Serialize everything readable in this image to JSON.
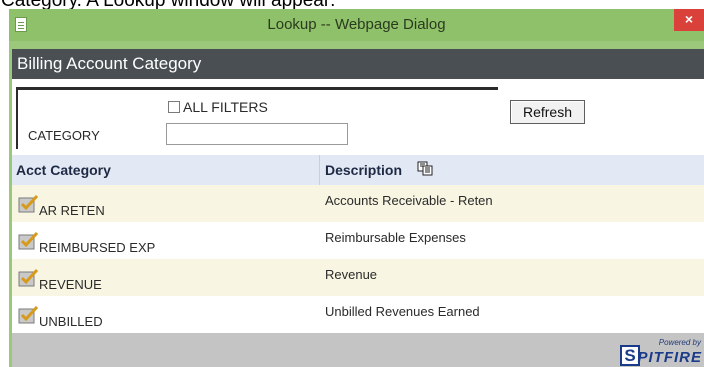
{
  "caption": "Category.  A Lookup window will appear:",
  "window": {
    "title": "Lookup -- Webpage Dialog",
    "close": "×"
  },
  "header": {
    "title": "Billing Account Category"
  },
  "filters": {
    "all_filters_label": "ALL FILTERS",
    "all_filters_checked": false,
    "category_label": "CATEGORY",
    "category_value": "",
    "refresh_label": "Refresh"
  },
  "grid": {
    "columns": [
      "Acct Category",
      "Description"
    ],
    "rows": [
      {
        "category": "AR RETEN",
        "description": "Accounts Receivable - Reten"
      },
      {
        "category": "REIMBURSED EXP",
        "description": "Reimbursable Expenses"
      },
      {
        "category": "REVENUE",
        "description": "Revenue"
      },
      {
        "category": "UNBILLED",
        "description": "Unbilled Revenues Earned"
      }
    ]
  },
  "footer": {
    "logo_powered": "Powered by",
    "logo_name": "PITFIRE",
    "logo_initial": "S"
  },
  "colors": {
    "accent_green": "#8fc16a",
    "header_band": "#4a4f53",
    "close_red": "#d9413a",
    "row_alt": "#f8f6e2",
    "grid_header": "#e2e8f4"
  },
  "icons": [
    "document-icon",
    "close-icon",
    "checkbox-icon",
    "sort-icon",
    "select-check-icon",
    "spitfire-logo"
  ]
}
